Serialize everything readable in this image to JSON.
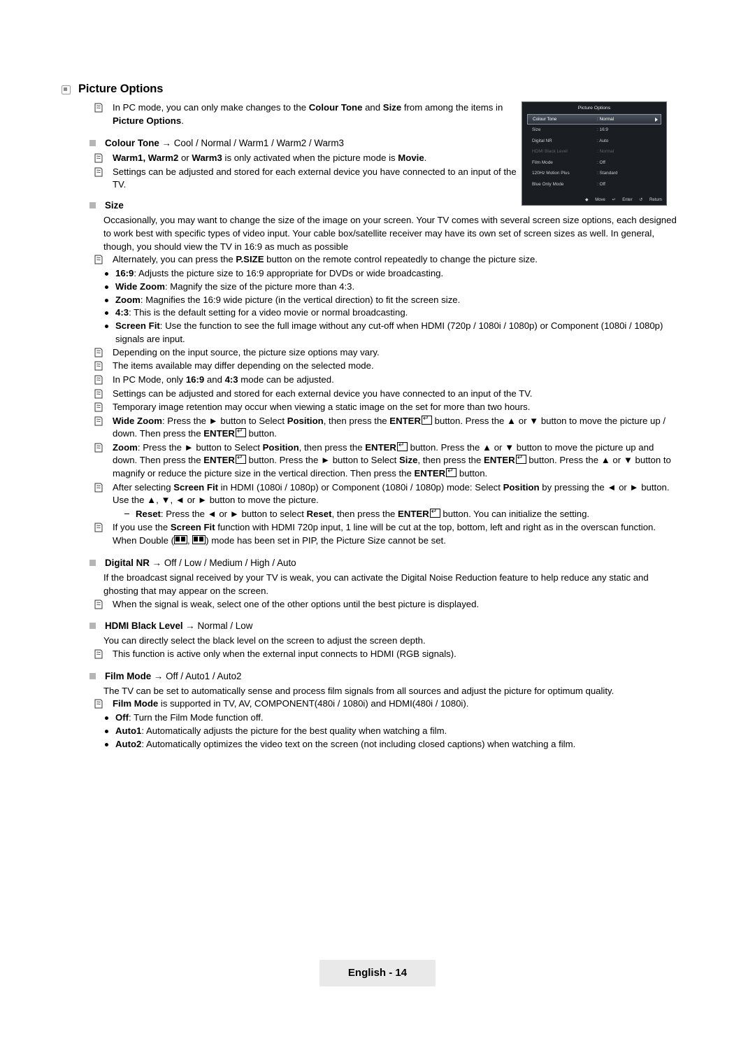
{
  "page": {
    "section_title": "Picture Options",
    "footer_label": "English - 14"
  },
  "intro": {
    "note1": "In PC mode, you can only make changes to the <b>Colour Tone</b> and <b>Size</b> from among the items in <b>Picture Options</b>."
  },
  "colour_tone": {
    "heading": "Colour Tone",
    "heading_options": "→ Cool / Normal / Warm1 / Warm2 / Warm3",
    "note1": "<b>Warm1, Warm2</b> or <b>Warm3</b> is only activated when the picture mode is <b>Movie</b>.",
    "note2": "Settings can be adjusted and stored for each external device you have connected to an input of the TV."
  },
  "size": {
    "heading": "Size",
    "para1": "Occasionally, you may want to change the size of the image on your screen. Your TV comes with several screen size options, each designed to work best with specific types of video input. Your cable box/satellite receiver may have its own set of screen sizes as well. In general, though, you should view the TV in 16:9 as much as possible",
    "note1": "Alternately, you can press the <b>P.SIZE</b> button on the remote control repeatedly to change the picture size.",
    "bullets": [
      "<b>16:9</b>: Adjusts the picture size to 16:9 appropriate for DVDs or wide broadcasting.",
      "<b>Wide Zoom</b>: Magnify the size of the picture more than 4:3.",
      "<b>Zoom</b>: Magnifies the 16:9 wide picture (in the vertical direction) to fit the screen size.",
      "<b>4:3</b>: This is the default setting for a video movie or normal broadcasting.",
      "<b>Screen Fit</b>: Use the function to see the full image without any cut-off when HDMI (720p / 1080i / 1080p) or Component (1080i / 1080p) signals are input."
    ],
    "notes": [
      "Depending on the input source, the picture size options may vary.",
      "The items available may differ depending on the selected mode.",
      "In PC Mode, only <b>16:9</b> and <b>4:3</b> mode can be adjusted.",
      "Settings can be adjusted and stored for each external device you have connected to an input of the TV.",
      "Temporary image retention may occur when viewing a static image on the set for more than two hours.",
      "<b>Wide Zoom</b>: Press the ► button to Select <b>Position</b>, then press the <b>ENTER</b><span class=\"enter-key\"></span> button. Press the ▲ or ▼ button to move the picture up / down. Then press the <b>ENTER</b><span class=\"enter-key\"></span> button.",
      "<b>Zoom</b>: Press the ► button to Select <b>Position</b>, then press the <b>ENTER</b><span class=\"enter-key\"></span> button. Press the ▲ or ▼ button to move the picture up and down. Then press the <b>ENTER</b><span class=\"enter-key\"></span> button. Press the ► button to Select <b>Size</b>, then press the <b>ENTER</b><span class=\"enter-key\"></span> button. Press the ▲ or ▼ button to magnify or reduce the picture size in the vertical direction. Then press the <b>ENTER</b><span class=\"enter-key\"></span> button.",
      "After selecting <b>Screen Fit</b> in HDMI (1080i / 1080p) or Component (1080i / 1080p) mode: Select <b>Position</b> by pressing the ◄ or ► button. Use the ▲, ▼, ◄ or ► button to move the picture.",
      "If you use the <b>Screen Fit</b> function with HDMI 720p input, 1 line will be cut at the top, bottom, left and right as in the overscan function."
    ],
    "reset_dash": "<b>Reset</b>: Press the ◄ or ► button to select <b>Reset</b>, then press the <b>ENTER</b><span class=\"enter-key\"></span> button. You can initialize the setting.",
    "double_note": "When Double (<span class=\"pipicon a\"></span>, <span class=\"pipicon b\"></span>) mode has been set in PIP, the Picture Size cannot be set."
  },
  "digital_nr": {
    "heading": "Digital NR",
    "heading_options": "→ Off / Low / Medium / High / Auto",
    "para1": "If the broadcast signal received by your TV is weak, you can activate the Digital Noise Reduction feature to help reduce any static and ghosting that may appear on the screen.",
    "note1": "When the signal is weak, select one of the other options until the best picture is displayed."
  },
  "hdmi_black_level": {
    "heading": "HDMI Black Level",
    "heading_options": "→ Normal / Low",
    "para1": "You can directly select the black level on the screen to adjust the screen depth.",
    "note1": "This function is active only when the external input connects to HDMI (RGB signals)."
  },
  "film_mode": {
    "heading": "Film Mode",
    "heading_options": "→ Off / Auto1 / Auto2",
    "para1": "The TV can be set to automatically sense and process film signals from all sources and adjust the picture for optimum quality.",
    "note1": "<b>Film Mode</b> is supported in TV, AV, COMPONENT(480i / 1080i) and HDMI(480i / 1080i).",
    "bullets": [
      "<b>Off</b>: Turn the Film Mode function off.",
      "<b>Auto1</b>: Automatically adjusts the picture for the best quality when watching a film.",
      "<b>Auto2</b>: Automatically optimizes the video text on the screen (not including closed captions) when watching a film."
    ]
  },
  "osd": {
    "title": "Picture Options",
    "rows": [
      {
        "label": "Colour Tone",
        "value": ": Normal",
        "state": "selected"
      },
      {
        "label": "Size",
        "value": ": 16:9",
        "state": "normal"
      },
      {
        "label": "Digital NR",
        "value": ": Auto",
        "state": "normal"
      },
      {
        "label": "HDMI Black Level",
        "value": ": Normal",
        "state": "dim"
      },
      {
        "label": "Film Mode",
        "value": ": Off",
        "state": "normal"
      },
      {
        "label": "120Hz Motion Plus",
        "value": ": Standard",
        "state": "normal"
      },
      {
        "label": "Blue Only Mode",
        "value": ": Off",
        "state": "normal"
      }
    ],
    "footer_move": "Move",
    "footer_enter": "Enter",
    "footer_return": "Return"
  }
}
